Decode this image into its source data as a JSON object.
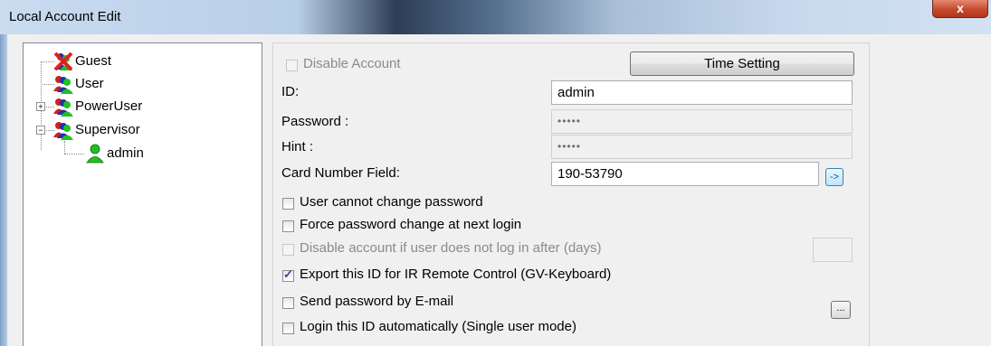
{
  "window": {
    "title": "Local Account Edit",
    "close_label": "x"
  },
  "tree": {
    "items": [
      {
        "label": "Guest",
        "icon": "disabled-user-icon"
      },
      {
        "label": "User",
        "icon": "user-group-icon"
      },
      {
        "label": "PowerUser",
        "icon": "user-group-icon"
      },
      {
        "label": "Supervisor",
        "icon": "user-group-icon"
      },
      {
        "label": "admin",
        "icon": "user-icon"
      }
    ],
    "expanders": {
      "poweruser": "+",
      "supervisor": "−"
    }
  },
  "form": {
    "disable_account_label": "Disable Account",
    "time_setting_label": "Time Setting",
    "id_label": "ID:",
    "id_value": "admin",
    "password_label": "Password :",
    "password_value": "•••••",
    "hint_label": "Hint :",
    "hint_value": "•••••",
    "card_number_label": "Card Number Field:",
    "card_number_value": "190-53790",
    "card_arrow_label": "->",
    "options": {
      "user_cannot_change": {
        "label": "User cannot change password",
        "checked": false,
        "enabled": true
      },
      "force_change": {
        "label": "Force password change at next login",
        "checked": false,
        "enabled": true
      },
      "disable_if_no_login": {
        "label": "Disable account if user does not log in after (days)",
        "checked": false,
        "enabled": false
      },
      "export_ir": {
        "label": "Export this ID for IR Remote Control (GV-Keyboard)",
        "checked": true,
        "enabled": true
      },
      "send_email": {
        "label": "Send password by E-mail",
        "checked": false,
        "enabled": true
      },
      "login_auto": {
        "label": "Login this ID automatically (Single user mode)",
        "checked": false,
        "enabled": true
      }
    },
    "days_value": "",
    "email_button_label": "..."
  },
  "colors": {
    "accent_check": "#2a4d8f",
    "close_red": "#c64a2f",
    "user_green": "#22c022",
    "guest_x_red": "#e02020"
  }
}
